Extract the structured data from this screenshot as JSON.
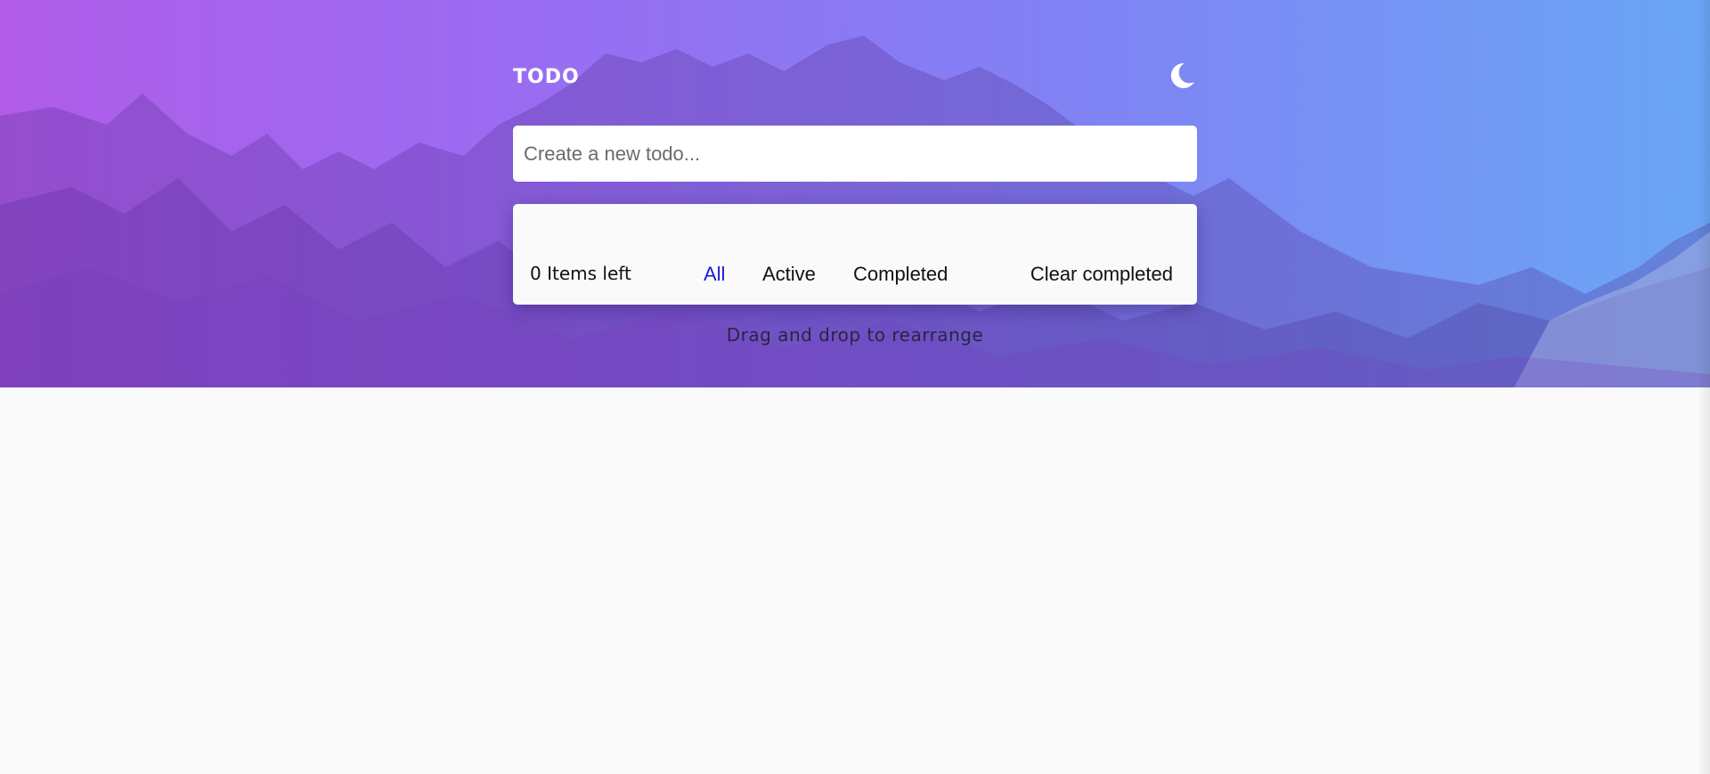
{
  "app": {
    "title": "TODO"
  },
  "theme_toggle": {
    "icon": "moon-icon"
  },
  "new_todo": {
    "placeholder": "Create a new todo...",
    "value": ""
  },
  "footer": {
    "items_left": "0 Items left",
    "filters": [
      {
        "label": "All",
        "selected": true
      },
      {
        "label": "Active",
        "selected": false
      },
      {
        "label": "Completed",
        "selected": false
      }
    ],
    "clear_label": "Clear completed"
  },
  "hint": "Drag and drop to rearrange",
  "colors": {
    "selected_filter": "#1a1adb",
    "gradient_start": "#b05ce8",
    "gradient_end": "#6aa6f5",
    "page_background": "#fafafa"
  }
}
